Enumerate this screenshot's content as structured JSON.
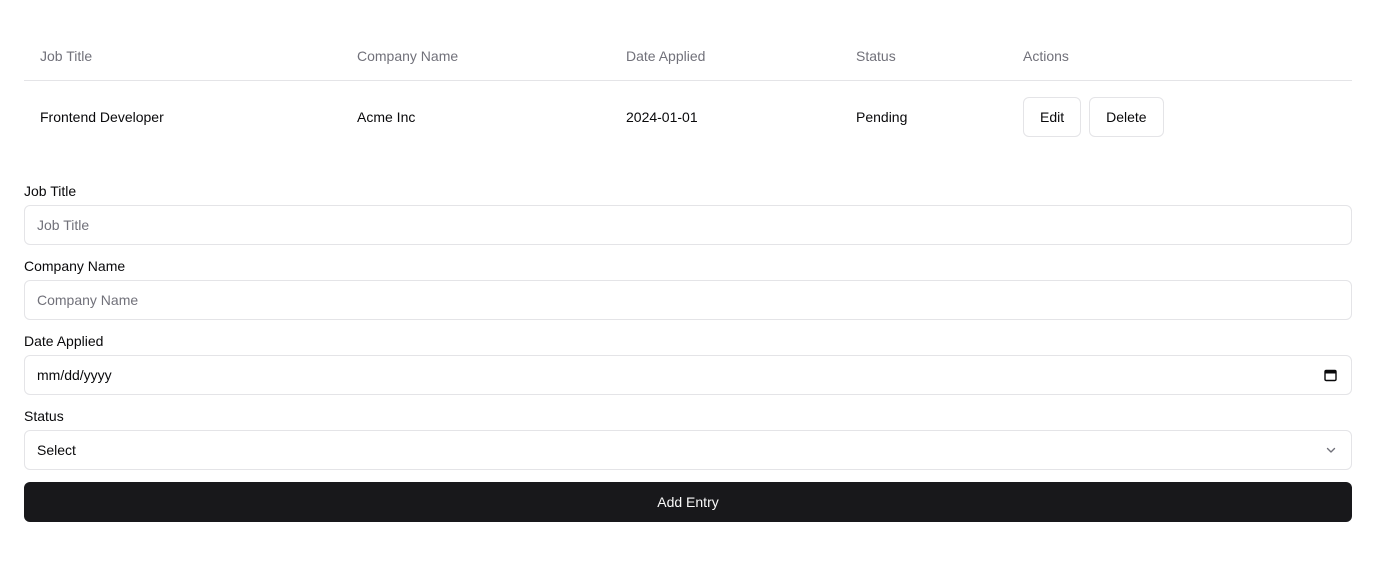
{
  "table": {
    "headers": [
      "Job Title",
      "Company Name",
      "Date Applied",
      "Status",
      "Actions"
    ],
    "rows": [
      {
        "job_title": "Frontend Developer",
        "company": "Acme Inc",
        "date": "2024-01-01",
        "status": "Pending",
        "edit_label": "Edit",
        "delete_label": "Delete"
      }
    ]
  },
  "form": {
    "job_title": {
      "label": "Job Title",
      "placeholder": "Job Title"
    },
    "company": {
      "label": "Company Name",
      "placeholder": "Company Name"
    },
    "date": {
      "label": "Date Applied",
      "placeholder": "mm/dd/yyyy",
      "icon": "calendar-icon"
    },
    "status": {
      "label": "Status",
      "value": "Select",
      "icon": "chevron-down-icon"
    },
    "submit_label": "Add Entry"
  },
  "colors": {
    "border": "#e4e4e7",
    "muted_text": "#71717a",
    "text": "#09090b",
    "primary_button": "#18181b",
    "primary_button_text": "#fafafa"
  }
}
